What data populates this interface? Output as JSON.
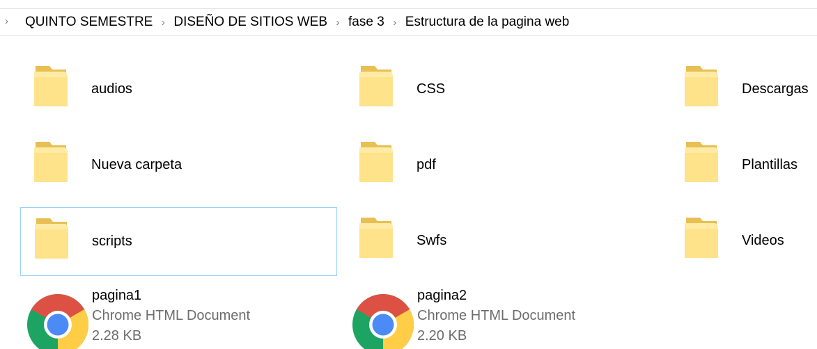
{
  "breadcrumb": {
    "lead_separator": "›",
    "separator": "›",
    "items": [
      "QUINTO SEMESTRE",
      "DISEÑO DE SITIOS WEB",
      "fase 3",
      "Estructura de la pagina web"
    ]
  },
  "folders": [
    {
      "label": "audios",
      "icon": "folder-icon",
      "selected": false
    },
    {
      "label": "CSS",
      "icon": "folder-icon",
      "selected": false
    },
    {
      "label": "Descargas",
      "icon": "folder-icon",
      "selected": false
    },
    {
      "label": "Nueva carpeta",
      "icon": "folder-icon",
      "selected": false
    },
    {
      "label": "pdf",
      "icon": "folder-icon",
      "selected": false
    },
    {
      "label": "Plantillas",
      "icon": "folder-icon",
      "selected": false
    },
    {
      "label": "scripts",
      "icon": "folder-icon",
      "selected": true
    },
    {
      "label": "Swfs",
      "icon": "folder-icon",
      "selected": false
    },
    {
      "label": "Videos",
      "icon": "folder-icon",
      "selected": false
    }
  ],
  "files": [
    {
      "name": "pagina1",
      "type": "Chrome HTML Document",
      "size": "2.28 KB",
      "icon": "chrome-icon"
    },
    {
      "name": "pagina2",
      "type": "Chrome HTML Document",
      "size": "2.20 KB",
      "icon": "chrome-icon"
    }
  ],
  "colors": {
    "selection_border": "#99d1ff",
    "folder_front": "#ffe38a",
    "folder_back": "#e8bf52",
    "secondary_text": "#6d6d6d"
  }
}
